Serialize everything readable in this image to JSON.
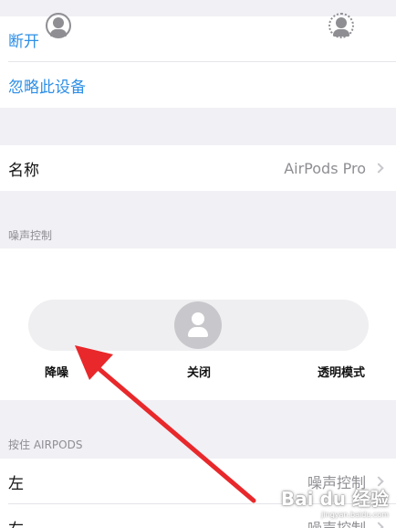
{
  "device_actions": {
    "disconnect_label": "断开",
    "forget_label": "忽略此设备"
  },
  "name_row": {
    "label": "名称",
    "value": "AirPods Pro"
  },
  "noise_control": {
    "header": "噪声控制",
    "options": [
      {
        "label": "降噪",
        "icon": "noise-cancellation-icon"
      },
      {
        "label": "关闭",
        "icon": "off-icon"
      },
      {
        "label": "透明模式",
        "icon": "transparency-icon"
      }
    ],
    "selected": "降噪"
  },
  "press_and_hold": {
    "header": "按住 AIRPODS",
    "rows": [
      {
        "label": "左",
        "value": "噪声控制"
      },
      {
        "label": "右",
        "value": "噪声控制"
      }
    ]
  },
  "annotation": {
    "arrow_color": "#e8282b"
  },
  "watermark": {
    "main": "Bai du 经验",
    "sub": "jingyan.baidu.com"
  },
  "colors": {
    "link": "#2e8fe6",
    "background": "#f0f0f5",
    "secondary_text": "#8e8e93"
  }
}
